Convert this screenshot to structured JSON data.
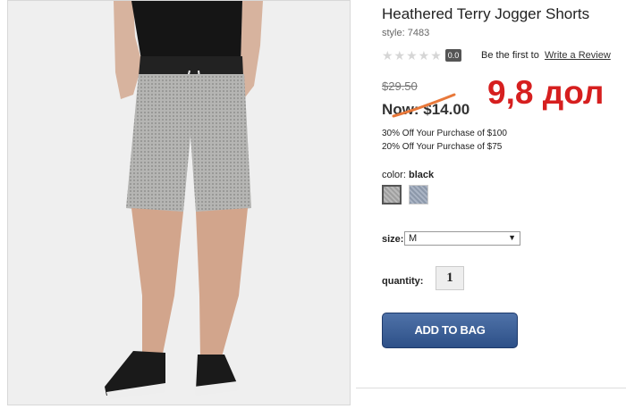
{
  "product": {
    "title": "Heathered Terry Jogger Shorts",
    "style": "style: 7483",
    "rating": {
      "stars": "★★★★★",
      "score": "0.0",
      "first_text": "Be the first to",
      "review_link": "Write a Review"
    },
    "old_price": "$29.50",
    "now_price": "Now: $14.00",
    "promos": [
      "30% Off Your Purchase of $100",
      "20% Off Your Purchase of $75"
    ],
    "color": {
      "label": "color:",
      "value": "black"
    },
    "size": {
      "label": "size:",
      "value": "M"
    },
    "quantity": {
      "label": "quantity:",
      "value": "1"
    },
    "add_to_bag": "ADD TO BAG"
  },
  "annotation": "9,8 дол",
  "colors": {
    "annotation": "#d61f1f",
    "button": "#2d5088"
  },
  "icons": {
    "size_caret": "▼"
  }
}
